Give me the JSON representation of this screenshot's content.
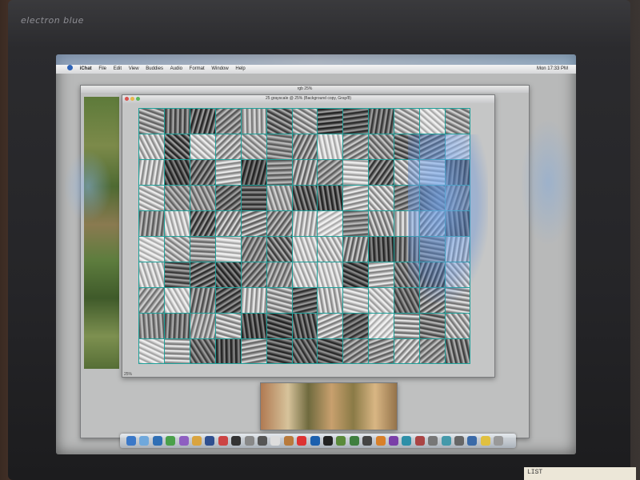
{
  "monitor": {
    "brand": "electron blue",
    "sticker_text": "LIST"
  },
  "menubar": {
    "app": "iChat",
    "items": [
      "File",
      "Edit",
      "View",
      "Buddies",
      "Audio",
      "Format",
      "Window",
      "Help"
    ],
    "clock": "Mon 17:33 PM"
  },
  "windows": {
    "main": {
      "title": "25 grayscale @ 25% (Background copy, Gray/8)",
      "status": "25%"
    },
    "background": {
      "title": "rgb 25%"
    },
    "colorstrip": {
      "title": ""
    }
  },
  "grid": {
    "rows": 10,
    "cols": 13,
    "line_color": "#1fa19a"
  },
  "dock": {
    "icons": [
      "finder-icon",
      "mail-icon",
      "safari-icon",
      "ichat-icon",
      "itunes-icon",
      "iphoto-icon",
      "photoshop-icon",
      "preview-icon",
      "terminal-icon",
      "system-preferences-icon",
      "calculator-icon",
      "textedit-icon",
      "address-book-icon",
      "ical-icon",
      "quicktime-icon",
      "dvd-player-icon",
      "image-capture-icon",
      "activity-monitor-icon",
      "console-icon",
      "illustrator-icon",
      "bridge-icon",
      "network-utility-icon",
      "font-book-icon",
      "disk-utility-icon",
      "airport-icon",
      "keychain-icon",
      "sherlock-icon",
      "stickies-icon",
      "trash-icon"
    ],
    "colors": [
      "#3a78c8",
      "#6fa8dc",
      "#2f6fb5",
      "#4aa04a",
      "#8e5fc1",
      "#d9a440",
      "#2f4f8f",
      "#c44",
      "#333",
      "#888",
      "#555",
      "#ddd",
      "#b87a3c",
      "#d33",
      "#1b5fae",
      "#222",
      "#5a8a3a",
      "#3f7f3f",
      "#444",
      "#d8802a",
      "#7a3fa8",
      "#2d8fa8",
      "#aa4444",
      "#777",
      "#49a",
      "#666",
      "#3a6aa8",
      "#e0c040",
      "#999"
    ]
  }
}
